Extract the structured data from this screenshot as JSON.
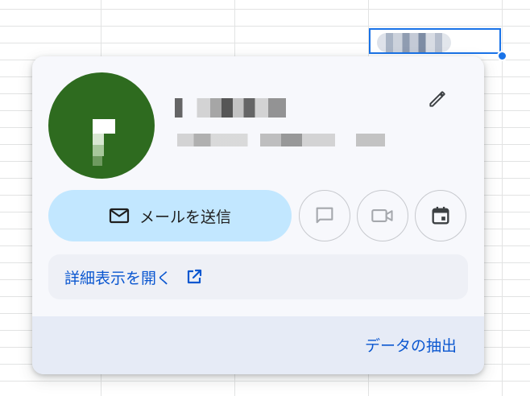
{
  "contact_card": {
    "send_mail_label": "メールを送信",
    "view_details_label": "詳細表示を開く",
    "export_label": "データの抽出"
  },
  "icons": {
    "edit": "pencil-icon",
    "mail": "mail-icon",
    "chat": "chat-icon",
    "video": "videocam-icon",
    "calendar": "calendar-icon",
    "open_external": "open-in-new-icon"
  },
  "colors": {
    "accent": "#1a73e8",
    "link": "#0b57d0",
    "primary_button": "#c2e7ff",
    "avatar_bg": "#2e6b1f",
    "card_bg": "#f7f8fc",
    "footer_bg": "#e6ebf6"
  }
}
